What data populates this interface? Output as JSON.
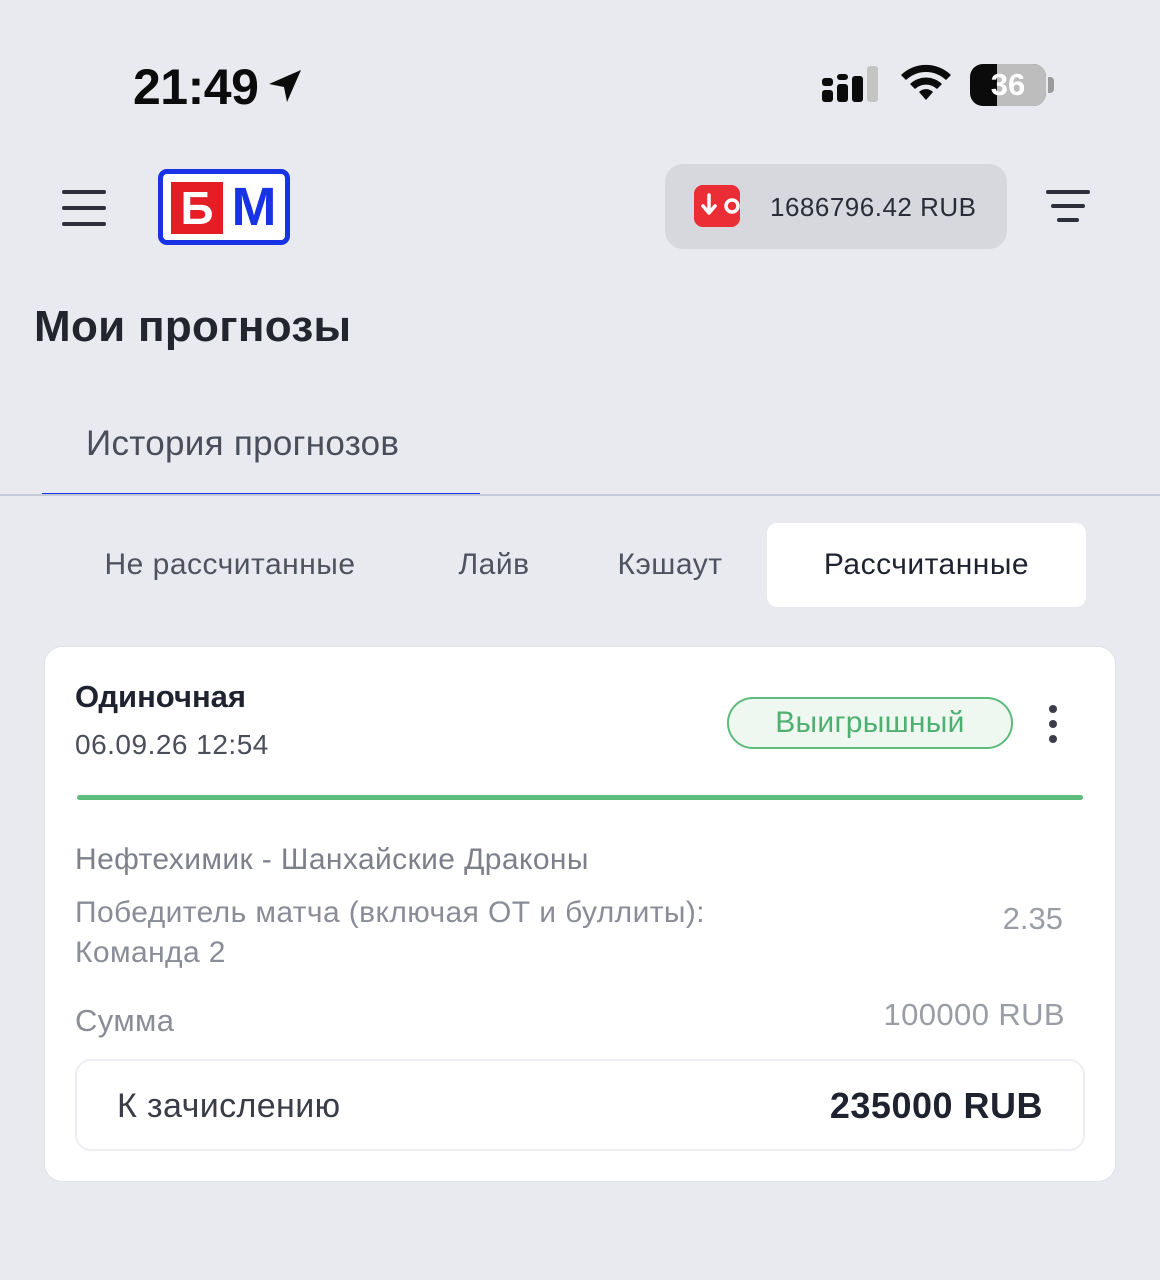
{
  "status_bar": {
    "time": "21:49",
    "battery_level": "36",
    "battery_fraction": 0.36,
    "icons": [
      "location-arrow-icon",
      "signal-icon",
      "wifi-icon",
      "battery-icon"
    ]
  },
  "header": {
    "menu_icon": "hamburger-menu-icon",
    "logo_text_left": "Б",
    "logo_text_right": "М",
    "wallet_icon": "wallet-icon",
    "balance": "1686796.42  RUB",
    "filter_icon": "filter-lines-icon"
  },
  "page": {
    "title": "Мои прогнозы"
  },
  "tabs": [
    {
      "label": "История прогнозов",
      "active": true
    }
  ],
  "filters": [
    {
      "label": "Не рассчитанные",
      "active": false
    },
    {
      "label": "Лайв",
      "active": false
    },
    {
      "label": "Кэшаут",
      "active": false
    },
    {
      "label": "Рассчитанные",
      "active": true
    }
  ],
  "bet": {
    "type": "Одиночная",
    "date": "06.09.26 12:54",
    "status": "Выигрышный",
    "progress": 1.0,
    "match": "Нефтехимик - Шанхайские Драконы",
    "market": "Победитель матча (включая ОТ и буллиты): Команда 2",
    "odds": "2.35",
    "stake_label": "Сумма",
    "stake_value": "100000 RUB",
    "payout_label": "К зачислению",
    "payout_value": "235000 RUB"
  },
  "colors": {
    "background": "#e9eaef",
    "accent_blue": "#1832e6",
    "logo_red": "#e51d25",
    "win_green": "#5dbb7c",
    "wallet_red": "#eb2e35"
  }
}
